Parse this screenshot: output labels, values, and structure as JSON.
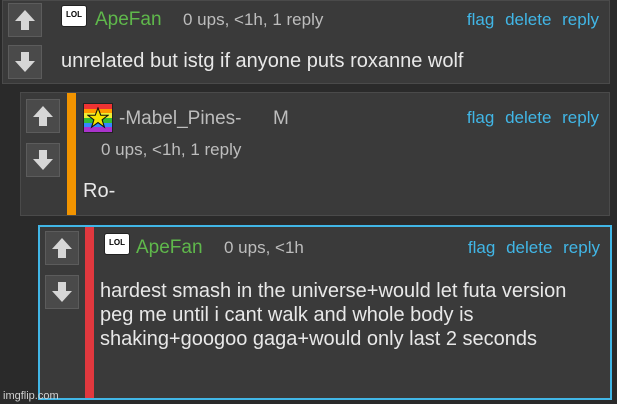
{
  "comments": [
    {
      "username": "ApeFan",
      "meta": "0 ups, <1h, 1 reply",
      "body": "unrelated but istg if anyone puts roxanne wolf",
      "badge": "LOL",
      "actions": {
        "flag": "flag",
        "delete": "delete",
        "reply": "reply"
      },
      "username_color": "#5fb84b"
    },
    {
      "username": "-Mabel_Pines-",
      "mod_tag": "M",
      "meta": "0 ups, <1h, 1 reply",
      "body": "Ro-",
      "avatar_icon": "rainbow-star-avatar",
      "actions": {
        "flag": "flag",
        "delete": "delete",
        "reply": "reply"
      },
      "accent_color": "#f29400",
      "username_color": "#bdbdbd"
    },
    {
      "username": "ApeFan",
      "meta": "0 ups, <1h",
      "body": "hardest smash in the universe+would let futa version peg me until i cant walk and whole body is shaking+googoo gaga+would only last 2 seconds",
      "badge": "LOL",
      "actions": {
        "flag": "flag",
        "delete": "delete",
        "reply": "reply"
      },
      "accent_color": "#e0383e",
      "border_color": "#41b6e6",
      "username_color": "#5fb84b"
    }
  ],
  "watermark": "imgflip.com",
  "colors": {
    "link": "#41b6e6",
    "background": "#2a2a2a",
    "panel": "#3a3a3a"
  }
}
